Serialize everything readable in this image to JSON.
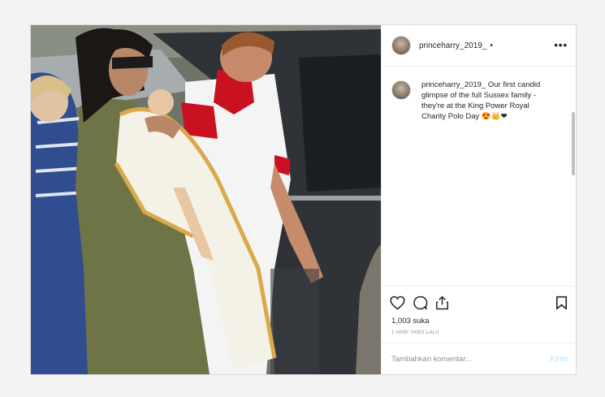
{
  "post": {
    "username": "princeharry_2019_",
    "header_dot": "•",
    "caption": {
      "username": "princeharry_2019_",
      "text": " Our first candid glimpse of the full Sussex family - they're at the King Power Royal Charity Polo Day 😍👑❤"
    },
    "likes": "1,003 suka",
    "timestamp": "1 HARI YANG LALU",
    "comment_placeholder": "Tambahkan komentar...",
    "send_label": "Kirim",
    "more_label": "•••"
  },
  "icons": {
    "like": "heart-icon",
    "comment": "comment-bubble-icon",
    "share": "share-icon",
    "save": "bookmark-icon"
  },
  "colors": {
    "border": "#dbdbdb",
    "text": "#262626",
    "muted": "#8e8e8e",
    "send_disabled": "#b2dffc"
  }
}
